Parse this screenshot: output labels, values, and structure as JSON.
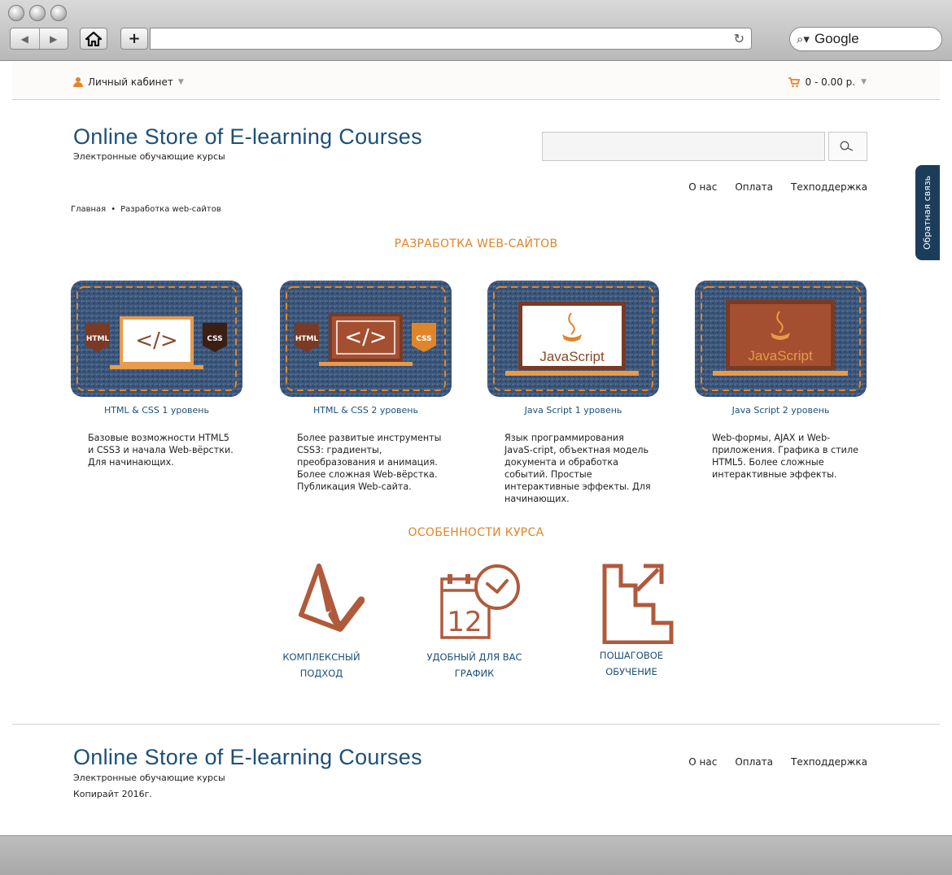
{
  "browser": {
    "back_label": "◀",
    "forward_label": "▶",
    "new_tab_label": "+",
    "search_engine": "Google"
  },
  "topbar": {
    "account_label": "Личный кабинет",
    "cart_summary": "0  - 0.00 р."
  },
  "header": {
    "title": "Online Store of E-learning Courses",
    "subtitle": "Электронные обучающие курсы",
    "search_placeholder": ""
  },
  "nav": {
    "items": [
      "О нас",
      "Оплата",
      "Техподдержка"
    ]
  },
  "feedback_label": "Обратная связь",
  "breadcrumb": [
    "Главная",
    "Разработка web-сайтов"
  ],
  "section_courses": "РАЗРАБОТКА WEB-САЙТОВ",
  "courses": [
    {
      "title": "HTML & CSS  1 уровень",
      "desc": "Базовые возможности HTML5 и CSS3 и начала Web-вёрстки. Для начинающих.",
      "badge_left": "HTML",
      "badge_right": "CSS",
      "screen_text": "</>"
    },
    {
      "title": "HTML & CSS  2 уровень",
      "desc": "Более развитые инструменты CSS3: градиенты, преобразования и анимация. Более сложная Web-вёрстка. Публикация Web-сайта.",
      "badge_left": "HTML",
      "badge_right": "CSS",
      "screen_text": "</>"
    },
    {
      "title": "Java Script  1 уровень",
      "desc": "Язык программирования JavaS-cript, объектная модель документа и обработка событий. Простые интерактивные эффекты. Для начинающих.",
      "screen_text": "JavaScript"
    },
    {
      "title": "Java Script  2 уровень",
      "desc": "Web-формы, AJAX и Web-приложения. Графика в стиле HTML5. Более сложные интерактивные эффекты.",
      "screen_text": "JavaScript"
    }
  ],
  "section_features": "ОСОБЕННОСТИ КУРСА",
  "features": [
    {
      "line1": "КОМПЛЕКСНЫЙ",
      "line2": "ПОДХОД"
    },
    {
      "line1": "УДОБНЫЙ ДЛЯ ВАС",
      "line2": "ГРАФИК",
      "calendar_number": "12"
    },
    {
      "line1": "ПОШАГОВОЕ",
      "line2": "ОБУЧЕНИЕ"
    }
  ],
  "footer": {
    "title": "Online Store of E-learning Courses",
    "subtitle": "Электронные обучающие курсы",
    "copyright": "Копирайт 2016г."
  },
  "colors": {
    "accent": "#e0852a",
    "brand": "#1c5078",
    "icon": "#b05a3c",
    "denim": "#3a5478"
  }
}
